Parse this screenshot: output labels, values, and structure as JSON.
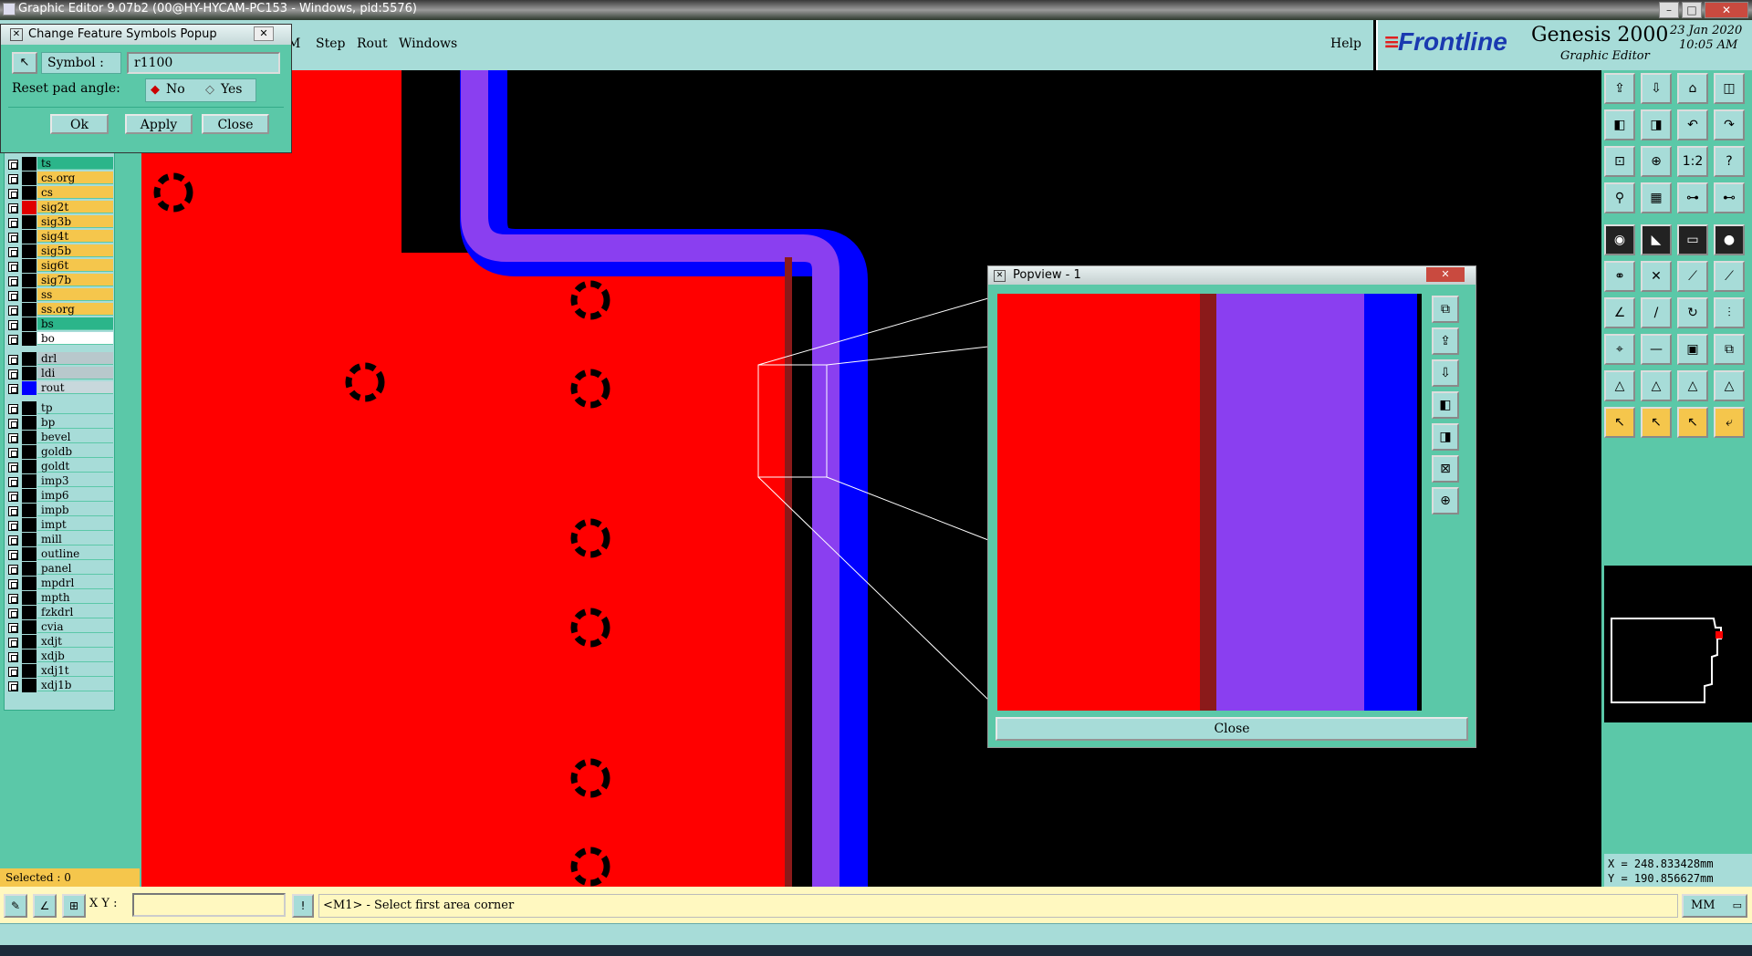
{
  "window": {
    "title": "Graphic Editor 9.07b2 (00@HY-HYCAM-PC153 - Windows, pid:5576)"
  },
  "menu": {
    "items": [
      "M",
      "Step",
      "Rout",
      "Windows"
    ],
    "help": "Help"
  },
  "brand": {
    "logo": "Frontline",
    "product": "Genesis 2000",
    "subtitle": "Graphic Editor",
    "date": "23 Jan 2020",
    "time": "10:05 AM"
  },
  "symbol_popup": {
    "title": "Change Feature Symbols Popup",
    "symbol_label": "Symbol :",
    "symbol_value": "r1100",
    "reset_label": "Reset pad angle:",
    "option_no": "No",
    "option_yes": "Yes",
    "selected_option": "No",
    "ok": "Ok",
    "apply": "Apply",
    "close": "Close"
  },
  "layers": {
    "board": [
      {
        "name": "ts",
        "color": "#2bb58a"
      },
      {
        "name": "cs.org",
        "color": "#f5c64c"
      },
      {
        "name": "cs",
        "color": "#f5c64c"
      },
      {
        "name": "sig2t",
        "color": "#f5c64c",
        "swatch": "#e00000"
      },
      {
        "name": "sig3b",
        "color": "#f5c64c"
      },
      {
        "name": "sig4t",
        "color": "#f5c64c"
      },
      {
        "name": "sig5b",
        "color": "#f5c64c"
      },
      {
        "name": "sig6t",
        "color": "#f5c64c"
      },
      {
        "name": "sig7b",
        "color": "#f5c64c"
      },
      {
        "name": "ss",
        "color": "#f5c64c"
      },
      {
        "name": "ss.org",
        "color": "#f5c64c"
      },
      {
        "name": "bs",
        "color": "#2bb58a"
      },
      {
        "name": "bo",
        "color": "#ffffff"
      }
    ],
    "drill": [
      {
        "name": "drl",
        "color": "#b8c8cc"
      },
      {
        "name": "ldi",
        "color": "#b8c8cc"
      },
      {
        "name": "rout",
        "color": "#c8d8dc",
        "swatch": "#0000ff"
      }
    ],
    "misc": [
      {
        "name": "tp",
        "color": "#a7dcd8"
      },
      {
        "name": "bp",
        "color": "#a7dcd8"
      },
      {
        "name": "bevel",
        "color": "#a7dcd8"
      },
      {
        "name": "goldb",
        "color": "#a7dcd8"
      },
      {
        "name": "goldt",
        "color": "#a7dcd8"
      },
      {
        "name": "imp3",
        "color": "#a7dcd8"
      },
      {
        "name": "imp6",
        "color": "#a7dcd8"
      },
      {
        "name": "impb",
        "color": "#a7dcd8"
      },
      {
        "name": "impt",
        "color": "#a7dcd8"
      },
      {
        "name": "mill",
        "color": "#a7dcd8"
      },
      {
        "name": "outline",
        "color": "#a7dcd8"
      },
      {
        "name": "panel",
        "color": "#a7dcd8"
      },
      {
        "name": "mpdrl",
        "color": "#a7dcd8"
      },
      {
        "name": "mpth",
        "color": "#a7dcd8"
      },
      {
        "name": "fzkdrl",
        "color": "#a7dcd8"
      },
      {
        "name": "cvia",
        "color": "#a7dcd8"
      },
      {
        "name": "xdjt",
        "color": "#a7dcd8"
      },
      {
        "name": "xdjb",
        "color": "#a7dcd8"
      },
      {
        "name": "xdj1t",
        "color": "#a7dcd8"
      },
      {
        "name": "xdj1b",
        "color": "#a7dcd8"
      }
    ]
  },
  "selected_label": "Selected : 0",
  "popview": {
    "title": "Popview - 1",
    "close": "Close"
  },
  "coords": {
    "x": "X = 248.833428mm",
    "y": "Y = 190.856627mm"
  },
  "bottom": {
    "xy_label": "X Y :",
    "xy_value": "",
    "prompt": "<M1> - Select first area corner",
    "units": "MM"
  },
  "toolbar_icons": [
    "open-icon",
    "save-icon",
    "home-icon",
    "split-icon",
    "arrow-left-icon",
    "arrow-right-icon",
    "undo-icon",
    "redo-icon",
    "zoom-fit-icon",
    "zoom-center-icon",
    "ratio-icon",
    "help-icon",
    "snap-icon",
    "grid-icon",
    "measure-icon",
    "measure2-icon",
    "pad-icon",
    "line-icon",
    "ruler-icon",
    "circle-icon",
    "node-icon",
    "cross-icon",
    "connect-icon",
    "connect2-icon",
    "angle-icon",
    "slash-icon",
    "rotate-icon",
    "split2-icon",
    "drill-icon",
    "minus-icon",
    "box-icon",
    "layer-icon",
    "triangle-icon",
    "triangle2-icon",
    "triangle3-icon",
    "triangle4-icon",
    "select-icon",
    "select2-icon",
    "select3-icon",
    "route-icon"
  ],
  "colors": {
    "copper": "#ff0000",
    "rout": "#0000ff",
    "violet": "#8a3ff0",
    "panel": "#5bc8a8",
    "light": "#a7dcd8"
  }
}
